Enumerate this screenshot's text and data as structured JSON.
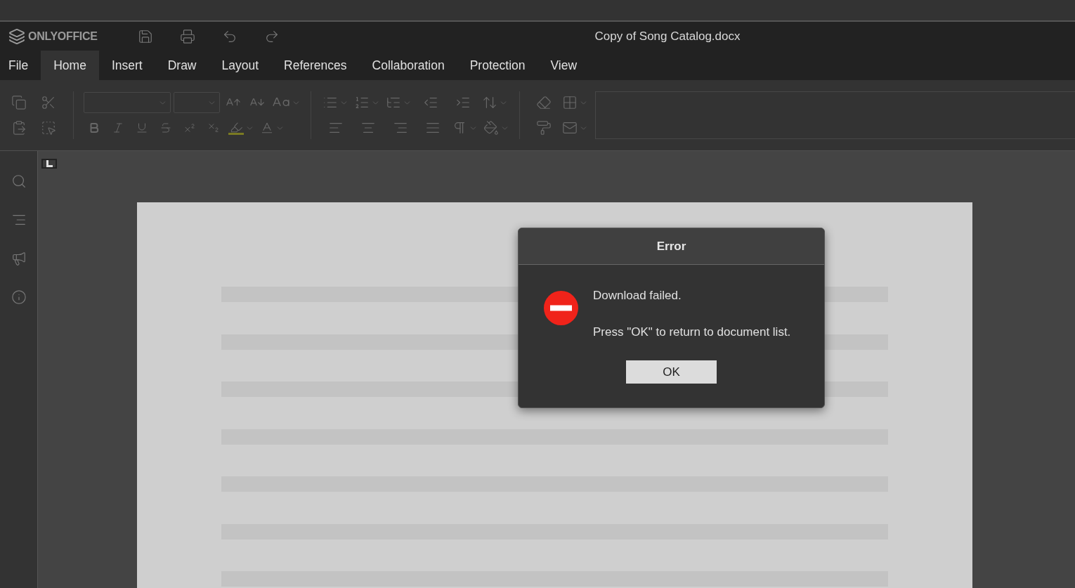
{
  "app": {
    "logo_text": "ONLYOFFICE",
    "document_title": "Copy of Song Catalog.docx"
  },
  "menu_tabs": [
    {
      "label": "File",
      "selected": false
    },
    {
      "label": "Home",
      "selected": true
    },
    {
      "label": "Insert",
      "selected": false
    },
    {
      "label": "Draw",
      "selected": false
    },
    {
      "label": "Layout",
      "selected": false
    },
    {
      "label": "References",
      "selected": false
    },
    {
      "label": "Collaboration",
      "selected": false
    },
    {
      "label": "Protection",
      "selected": false
    },
    {
      "label": "View",
      "selected": false
    }
  ],
  "dialog": {
    "title": "Error",
    "message": "Download failed.",
    "hint": "Press \"OK\" to return to document list.",
    "button": "OK"
  }
}
